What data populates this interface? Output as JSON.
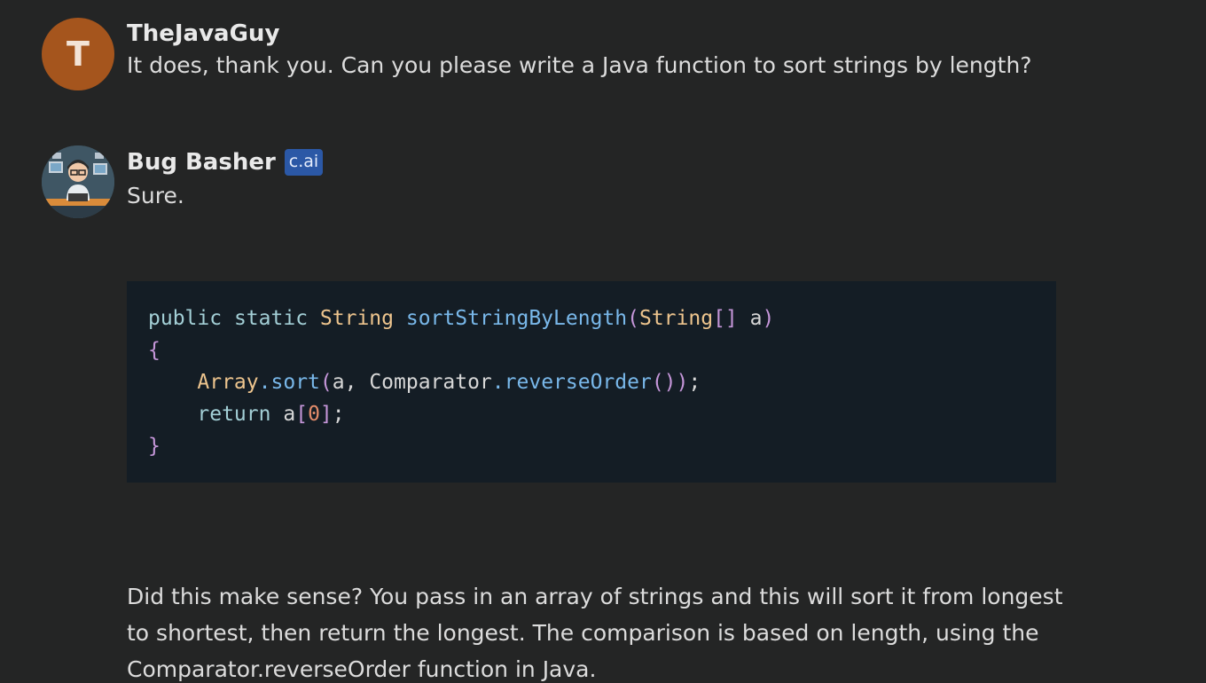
{
  "messages": [
    {
      "author": "TheJavaGuy",
      "avatar_letter": "T",
      "text": "It does, thank you. Can you please write a Java function to sort strings by length?"
    },
    {
      "author": "Bug Basher",
      "badge": "c.ai",
      "avatar_icon": "developer-avatar-icon",
      "text": "Sure.",
      "code": {
        "line1": {
          "kw1": "public",
          "kw2": "static",
          "type": "String",
          "fn": "sortStringByLength",
          "p1": "(",
          "type2": "String",
          "p2": "[]",
          "arg": "a",
          "p3": ")"
        },
        "line2": {
          "brace": "{"
        },
        "line3": {
          "type": "Array",
          "dot1": ".",
          "fn1": "sort",
          "p1": "(",
          "arg": "a,",
          "cls": "Comparator",
          "dot2": ".",
          "fn2": "reverseOrder",
          "p2": "()",
          "p3": ")",
          "semi": ";"
        },
        "line4": {
          "kw": "return",
          "var": "a",
          "p1": "[",
          "num": "0",
          "p2": "]",
          "semi": ";"
        },
        "line5": {
          "brace": "}"
        }
      },
      "followup": "Did this make sense? You pass in an array of strings and this will sort it from longest to shortest, then return the longest. The comparison is based on length, using the Comparator.reverseOrder function in Java."
    }
  ],
  "colors": {
    "background": "#242525",
    "code_background": "#141d25",
    "badge": "#2b58a6",
    "user_avatar": "#a5551d"
  }
}
